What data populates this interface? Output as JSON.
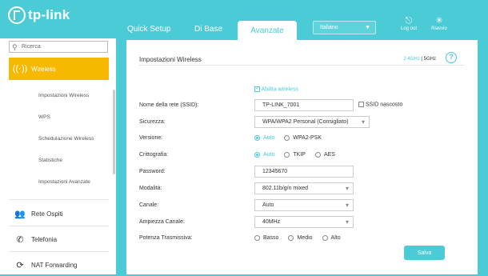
{
  "brand": {
    "logo_text": "tp-link"
  },
  "tabs": [
    {
      "label": "Quick Setup"
    },
    {
      "label": "Di Base"
    },
    {
      "label": "Avanzate"
    }
  ],
  "language": {
    "selected": "Italiano"
  },
  "header_actions": {
    "logout": "Log out",
    "reboot": "Riavvio"
  },
  "sidebar": {
    "search_placeholder": "Ricerca",
    "active_section": "Wireless",
    "sub_items": [
      "Impostazioni Wireless",
      "WPS",
      "Schedulazione Wireless",
      "Statistiche",
      "Impostazioni Avanzate"
    ],
    "sections": [
      "Rete Ospiti",
      "Telefonia",
      "NAT Forwarding"
    ]
  },
  "panel": {
    "title": "Impostazioni Wireless",
    "band_24": "2.4GHz",
    "band_sep": "|",
    "band_5": "5GHz",
    "help": "?",
    "enable_wireless": "Abilita wireless",
    "fields": {
      "ssid_label": "Nome della rete (SSID):",
      "ssid_value": "TP-LINK_7001",
      "ssid_hidden": "SSID nascosto",
      "security_label": "Sicurezza:",
      "security_value": "WPA/WPA2 Personal (Consigliato)",
      "version_label": "Versione:",
      "version_options": [
        "Auto",
        "WPA2-PSK"
      ],
      "encryption_label": "Crittografia:",
      "encryption_options": [
        "Auto",
        "TKIP",
        "AES"
      ],
      "password_label": "Password:",
      "password_value": "12345670",
      "mode_label": "Modalità:",
      "mode_value": "802.11b/g/n mixed",
      "channel_label": "Canale:",
      "channel_value": "Auto",
      "width_label": "Ampiezza Canale:",
      "width_value": "40MHz",
      "power_label": "Potenza Trasmissiva:",
      "power_options": [
        "Basso",
        "Medio",
        "Alto"
      ]
    },
    "save_label": "Salva"
  },
  "colors": {
    "accent": "#4acbd6",
    "active_nav": "#f6b900"
  }
}
